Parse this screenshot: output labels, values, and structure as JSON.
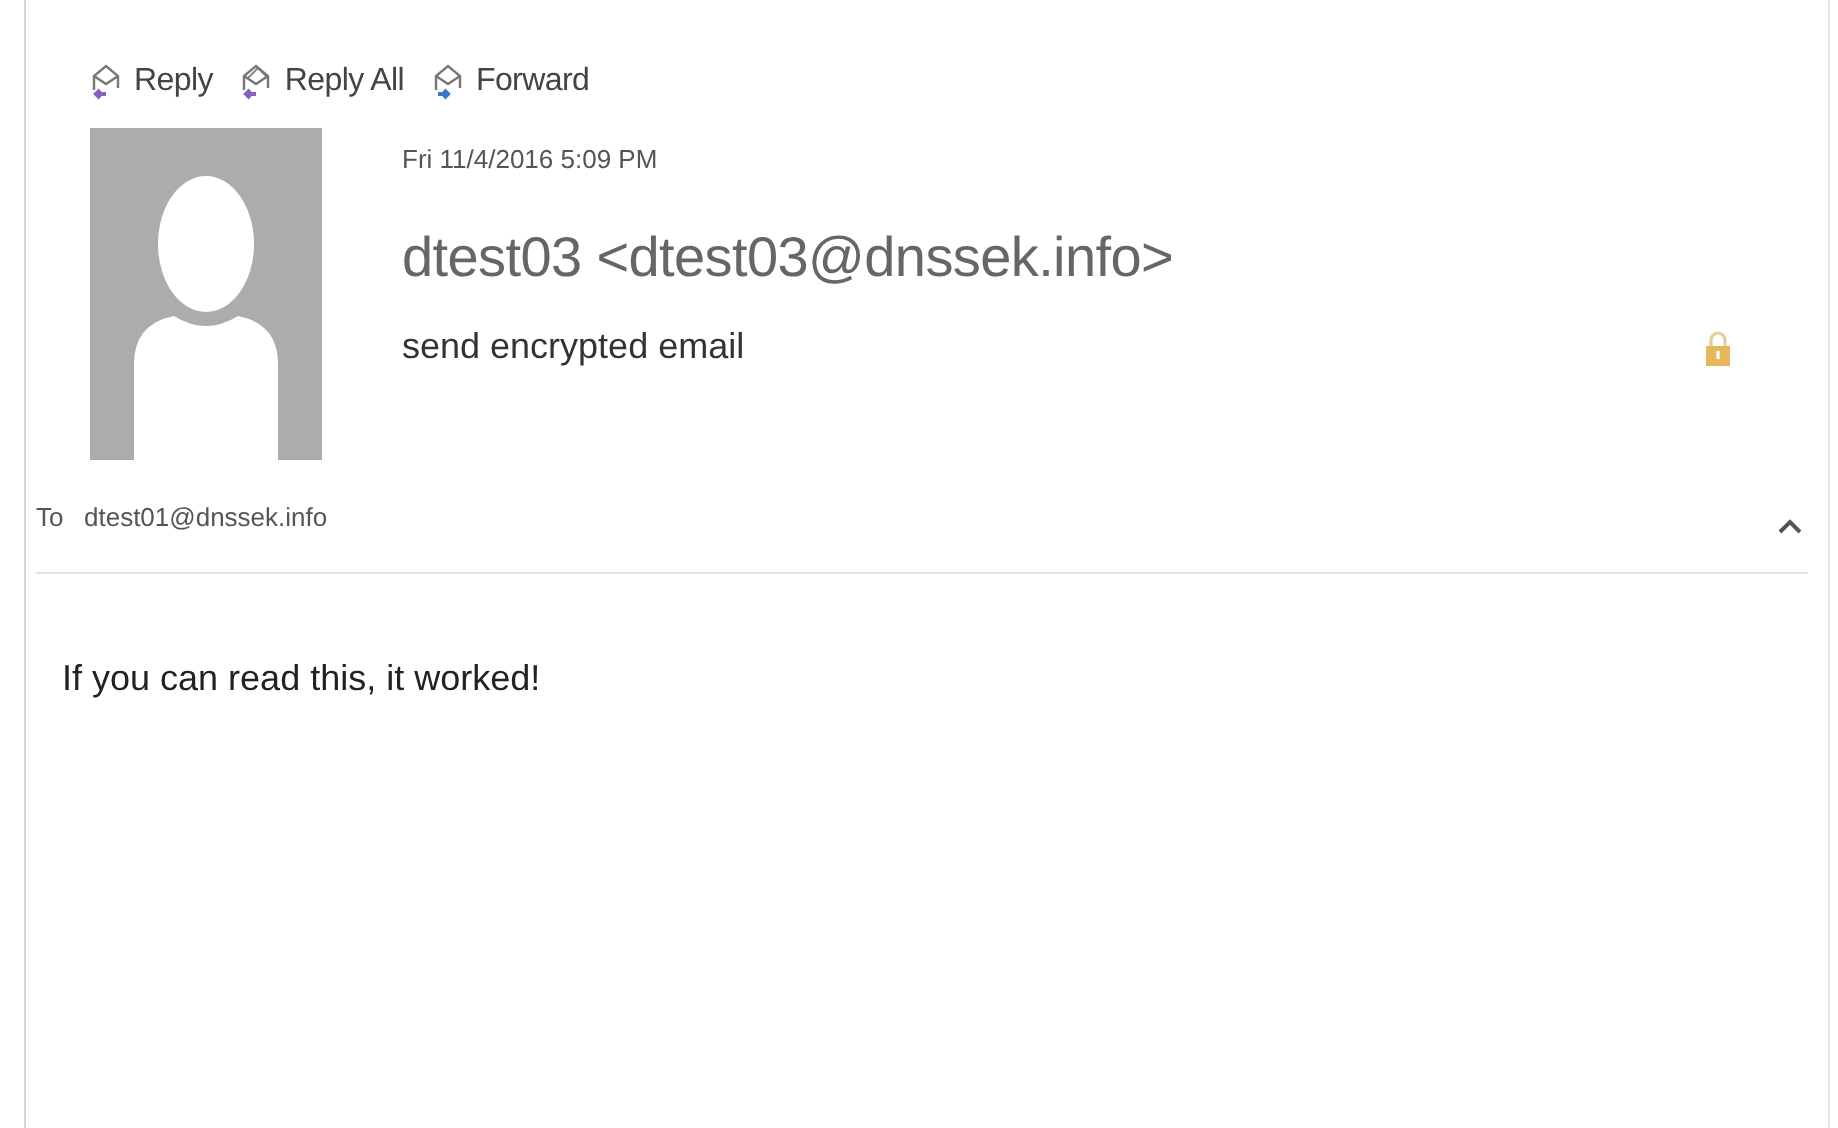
{
  "actions": [
    {
      "label": "Reply",
      "kind": "reply"
    },
    {
      "label": "Reply All",
      "kind": "reply_all"
    },
    {
      "label": "Forward",
      "kind": "forward"
    }
  ],
  "message": {
    "date": "Fri 11/4/2016 5:09 PM",
    "sender": "dtest03 <dtest03@dnssek.info>",
    "subject": "send encrypted email",
    "encrypted": true,
    "to_label": "To",
    "to": "dtest01@dnssek.info",
    "expanded": true
  },
  "body": "If you can read this, it worked!"
}
